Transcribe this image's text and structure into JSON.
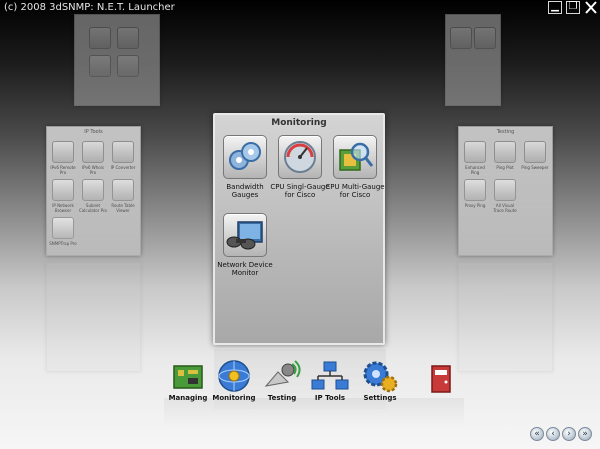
{
  "window": {
    "title": "(c) 2008 3dSNMP: N.E.T. Launcher",
    "buttons": [
      "minimize",
      "restore",
      "close"
    ]
  },
  "panels": {
    "monitoring": {
      "title": "Monitoring",
      "items": [
        {
          "label": "Bandwidth Gauges",
          "icon": "bandwidth-gauges-icon"
        },
        {
          "label": "CPU Singl-Gauge for Cisco",
          "icon": "cpu-single-gauge-icon"
        },
        {
          "label": "CPU Multi-Gauge for Cisco",
          "icon": "cpu-multi-gauge-icon"
        },
        {
          "label": "Network Device Monitor",
          "icon": "binoculars-monitor-icon"
        }
      ]
    },
    "ip_tools": {
      "title": "IP Tools",
      "items": [
        "IPv6 Remote Pro",
        "IPv6 Whois Pro",
        "IP Converter",
        "IP Network Browser",
        "Subnet Calculator Pro",
        "Route Table Viewer",
        "SNMPTrap Pro"
      ]
    },
    "testing": {
      "title": "Testing",
      "items": [
        "Enhanced Ping",
        "Ping Plot",
        "Ping Sweeper",
        "Proxy Ping",
        "All Visual Trace Route"
      ]
    }
  },
  "dock": [
    {
      "label": "Managing",
      "icon": "managing-board-icon"
    },
    {
      "label": "Monitoring",
      "icon": "monitoring-globe-icon"
    },
    {
      "label": "Testing",
      "icon": "testing-satellite-icon"
    },
    {
      "label": "IP Tools",
      "icon": "ip-tools-network-icon"
    },
    {
      "label": "Settings",
      "icon": "settings-gears-icon"
    },
    {
      "label": "Exit",
      "icon": "exit-door-icon"
    }
  ],
  "nav": [
    "nav-first",
    "nav-prev",
    "nav-next",
    "nav-last"
  ],
  "colors": {
    "accent_blue": "#3a7bd5",
    "text_dark": "#111111"
  }
}
